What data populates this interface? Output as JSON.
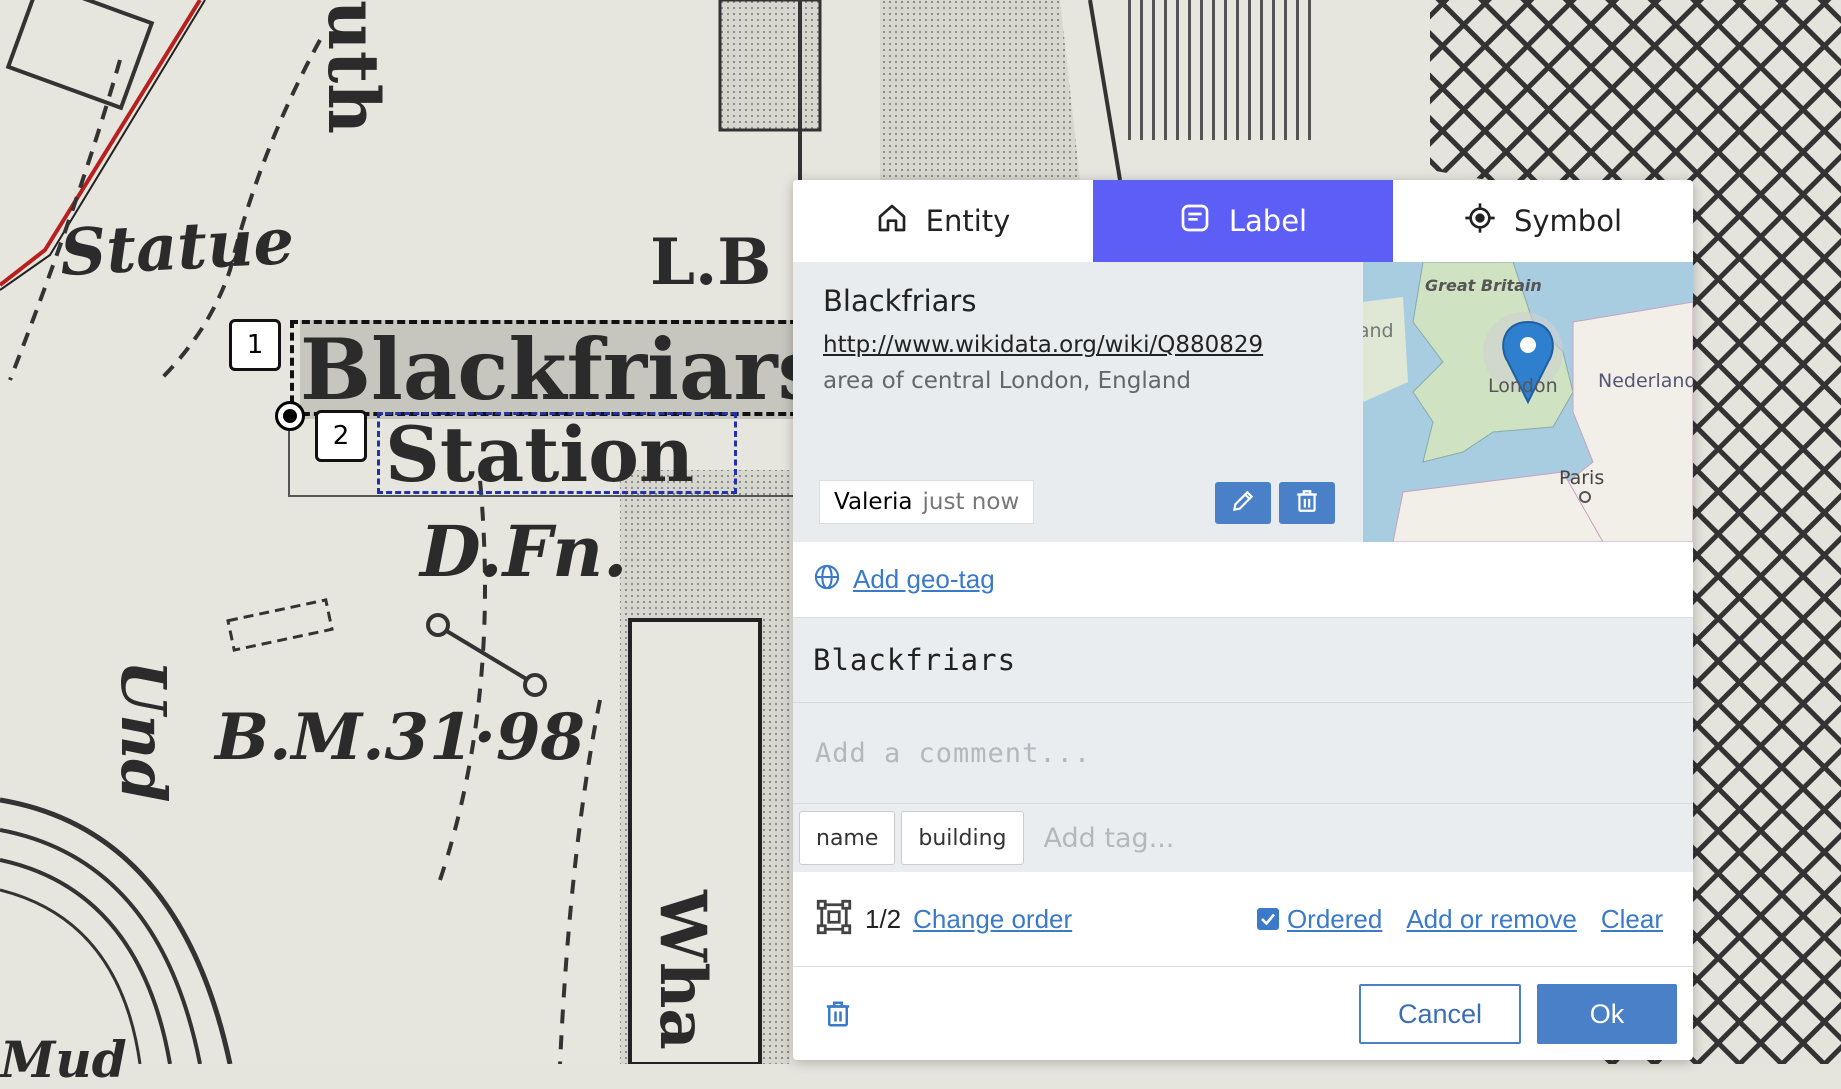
{
  "map": {
    "labels": {
      "statue": "Statue",
      "street_partial": "uth",
      "lb": "L.B",
      "blackfriars": "Blackfriars",
      "station": "Station",
      "dfn": "D.Fn.",
      "bm": "B.M.31·98",
      "und": "Und",
      "wha": "Wha",
      "mud": "Mud"
    }
  },
  "annotations": {
    "box1_number": "1",
    "box2_number": "2"
  },
  "popup": {
    "tabs": [
      {
        "label": "Entity",
        "icon": "home-icon",
        "active": false
      },
      {
        "label": "Label",
        "icon": "note-icon",
        "active": true
      },
      {
        "label": "Symbol",
        "icon": "crosshair-icon",
        "active": false
      }
    ],
    "entity": {
      "title": "Blackfriars",
      "url": "http://www.wikidata.org/wiki/Q880829",
      "description": "area of central London, England",
      "author": "Valeria",
      "time": "just now",
      "mini_map_labels": {
        "great_britain": "Great Britain",
        "eire": "Éire / Ireland",
        "london": "London",
        "nederland": "Nederland",
        "paris": "Paris"
      }
    },
    "geotag_link": "Add geo-tag",
    "label_value": "Blackfriars",
    "comment_placeholder": "Add a comment...",
    "tags": [
      "name",
      "building"
    ],
    "tag_placeholder": "Add tag...",
    "order": {
      "count": "1/2",
      "change_order": "Change order",
      "ordered": "Ordered",
      "ordered_checked": true,
      "add_or_remove": "Add or remove",
      "clear": "Clear"
    },
    "buttons": {
      "cancel": "Cancel",
      "ok": "Ok"
    },
    "colors": {
      "accent_tab": "#5d5ef5",
      "primary_button": "#4a80c8",
      "link": "#3b7ac8"
    }
  }
}
